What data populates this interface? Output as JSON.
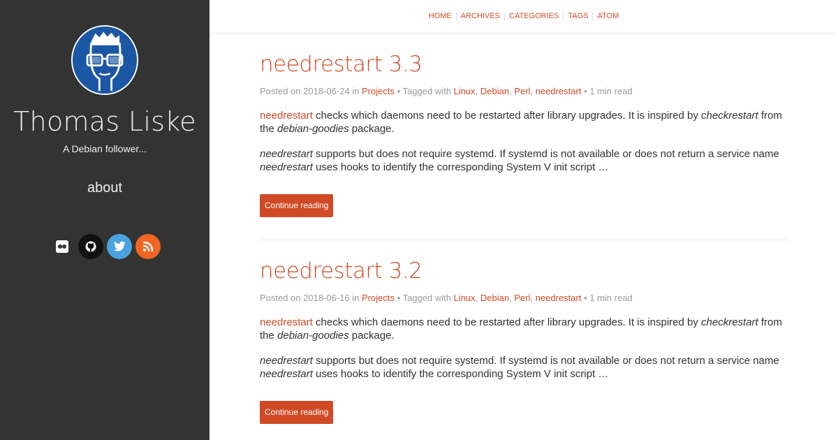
{
  "sidebar": {
    "title": "Thomas Liske",
    "subtitle": "A Debian follower...",
    "about": "about",
    "social": [
      {
        "name": "flickr-icon",
        "color": "#ffffff"
      },
      {
        "name": "github-icon",
        "color": "#111111"
      },
      {
        "name": "twitter-icon",
        "color": "#4aa3df"
      },
      {
        "name": "rss-icon",
        "color": "#f26522"
      }
    ]
  },
  "nav": {
    "items": [
      "HOME",
      "ARCHIVES",
      "CATEGORIES",
      "TAGS",
      "ATOM"
    ]
  },
  "posts": [
    {
      "title": "needrestart 3.3",
      "posted_on": "Posted on",
      "date": "2018-06-24",
      "in": "in",
      "category": "Projects",
      "tagged_with": "• Tagged with",
      "tags": [
        "Linux",
        "Debian",
        "Perl",
        "needrestart"
      ],
      "reading_time": "• 1 min read",
      "p1_link": "needrestart",
      "p1_text1": " checks which daemons need to be restarted after library upgrades. It is inspired by ",
      "p1_em1": "checkrestart",
      "p1_text2": " from the ",
      "p1_em2": "debian-goodies",
      "p1_text3": " package.",
      "p2_em1": "needrestart",
      "p2_text1": " supports but does not require systemd. If systemd is not available or does not return a service name ",
      "p2_em2": "needrestart",
      "p2_text2": " uses hooks to identify the corresponding System V init script …",
      "continue": "Continue reading"
    },
    {
      "title": "needrestart 3.2",
      "posted_on": "Posted on",
      "date": "2018-06-16",
      "in": "in",
      "category": "Projects",
      "tagged_with": "• Tagged with",
      "tags": [
        "Linux",
        "Debian",
        "Perl",
        "needrestart"
      ],
      "reading_time": "• 1 min read",
      "p1_link": "needrestart",
      "p1_text1": " checks which daemons need to be restarted after library upgrades. It is inspired by ",
      "p1_em1": "checkrestart",
      "p1_text2": " from the ",
      "p1_em2": "debian-goodies",
      "p1_text3": " package.",
      "p2_em1": "needrestart",
      "p2_text1": " supports but does not require systemd. If systemd is not available or does not return a service name ",
      "p2_em2": "needrestart",
      "p2_text2": " uses hooks to identify the corresponding System V init script …",
      "continue": "Continue reading"
    }
  ],
  "colors": {
    "sidebar_bg": "#333333",
    "accent": "#d04a25",
    "avatar_bg": "#1c57a5"
  }
}
